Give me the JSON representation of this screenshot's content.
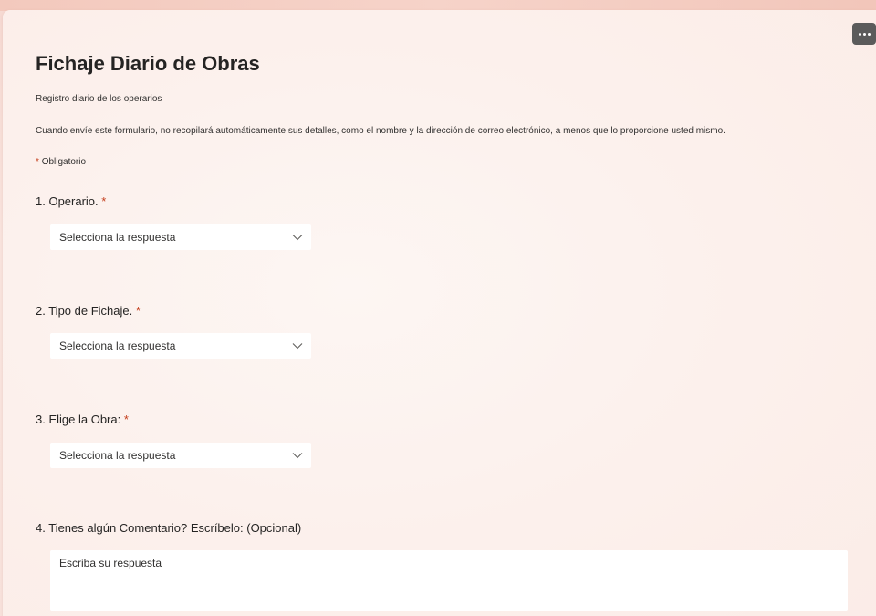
{
  "form": {
    "title": "Fichaje Diario de Obras",
    "subtitle": "Registro diario de los operarios",
    "notice": "Cuando envíe este formulario, no recopilará automáticamente sus detalles, como el nombre y la dirección de correo electrónico, a menos que lo proporcione usted mismo.",
    "required_star": "*",
    "required_label": "Obligatorio"
  },
  "questions": [
    {
      "label": "1. Operario.",
      "required": "*",
      "placeholder": "Selecciona la respuesta"
    },
    {
      "label": "2. Tipo de Fichaje.",
      "required": "*",
      "placeholder": "Selecciona la respuesta"
    },
    {
      "label": "3. Elige la Obra:",
      "required": "*",
      "placeholder": "Selecciona la respuesta"
    },
    {
      "label": "4. Tienes algún Comentario? Escríbelo: (Opcional)",
      "placeholder": "Escriba su respuesta"
    }
  ],
  "icons": {
    "more": "more-horizontal-icon",
    "dropdown": "chevron-down-icon"
  },
  "colors": {
    "required_star": "#c43e1c",
    "more_button_bg": "#5b5b5b"
  }
}
